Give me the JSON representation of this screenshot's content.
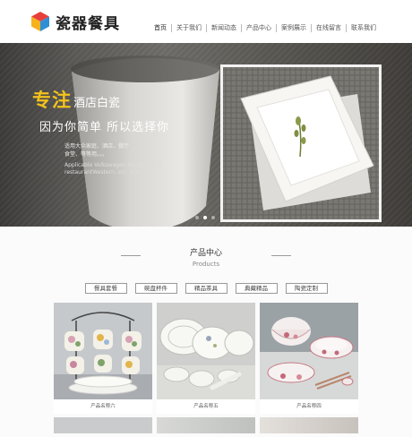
{
  "header": {
    "logo_text": "瓷器餐具",
    "nav": [
      {
        "label": "首页",
        "active": true
      },
      {
        "label": "关于我们",
        "active": false
      },
      {
        "label": "新闻动态",
        "active": false
      },
      {
        "label": "产品中心",
        "active": false
      },
      {
        "label": "案例展示",
        "active": false
      },
      {
        "label": "在线留言",
        "active": false
      },
      {
        "label": "联系我们",
        "active": false
      }
    ]
  },
  "banner": {
    "highlight": "专注",
    "headline_rest": "酒店白瓷",
    "subheadline": "因为你简单 所以选择你",
    "desc_cn_1": "适用大众家庭、酒店、餐厅",
    "desc_cn_2": "食堂、等等用。。。",
    "desc_en_1": "Applicable Volkswagen family, hotel,",
    "desc_en_2": "restaurantWestern, etc. use. . .",
    "slides": 3,
    "active_slide": 2,
    "accent_color": "#f4c21c"
  },
  "products": {
    "title": "产品中心",
    "subtitle": "Products",
    "categories": [
      "餐具套餐",
      "碗盘杯件",
      "精品茶具",
      "典藏精品",
      "陶瓷定制"
    ],
    "items": [
      {
        "caption": "产品名称六"
      },
      {
        "caption": "产品名称五"
      },
      {
        "caption": "产品名称四"
      }
    ]
  }
}
